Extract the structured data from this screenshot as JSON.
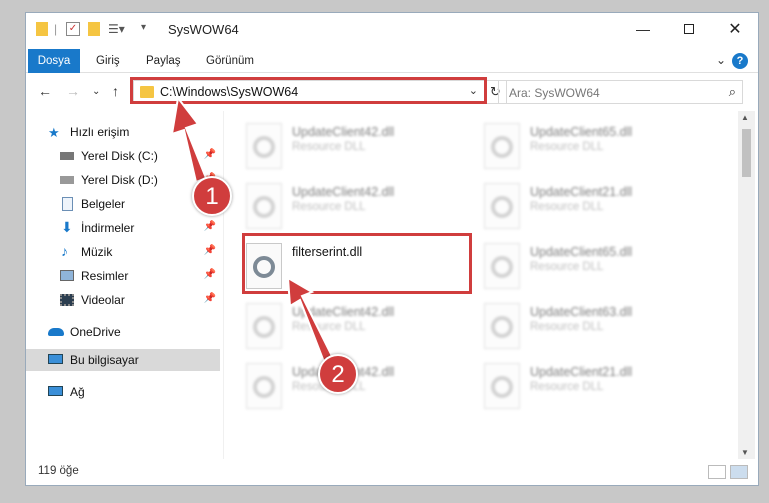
{
  "window": {
    "title": "SysWOW64",
    "minimize_icon": "minimize-icon",
    "maximize_icon": "maximize-icon",
    "close_icon": "close-icon"
  },
  "ribbon": {
    "tabs": [
      "Dosya",
      "Giriş",
      "Paylaş",
      "Görünüm"
    ],
    "help": "?"
  },
  "nav": {
    "back_icon": "back-arrow-icon",
    "forward_icon": "forward-arrow-icon",
    "up_icon": "up-arrow-icon",
    "address": "C:\\Windows\\SysWOW64",
    "search_placeholder": "Ara: SysWOW64"
  },
  "sidebar": {
    "items": [
      {
        "label": "Hızlı erişim",
        "icon": "star-icon",
        "pinned": false
      },
      {
        "label": "Yerel Disk (C:)",
        "icon": "drive-icon",
        "pinned": true
      },
      {
        "label": "Yerel Disk (D:)",
        "icon": "drive-icon",
        "pinned": true
      },
      {
        "label": "Belgeler",
        "icon": "documents-icon",
        "pinned": true
      },
      {
        "label": "İndirmeler",
        "icon": "download-icon",
        "pinned": true
      },
      {
        "label": "Müzik",
        "icon": "music-icon",
        "pinned": true
      },
      {
        "label": "Resimler",
        "icon": "pictures-icon",
        "pinned": true
      },
      {
        "label": "Videolar",
        "icon": "videos-icon",
        "pinned": true
      },
      {
        "label": "OneDrive",
        "icon": "cloud-icon",
        "pinned": false
      },
      {
        "label": "Bu bilgisayar",
        "icon": "computer-icon",
        "pinned": false
      },
      {
        "label": "Ağ",
        "icon": "network-icon",
        "pinned": false
      }
    ]
  },
  "files": [
    {
      "name": "UpdateClient42.dll",
      "type": "Resource DLL"
    },
    {
      "name": "UpdateClient65.dll",
      "type": "Resource DLL"
    },
    {
      "name": "UpdateClient42.dll",
      "type": "Resource DLL"
    },
    {
      "name": "UpdateClient21.dll",
      "type": "Resource DLL"
    },
    {
      "name": "filterserint.dll",
      "type": ""
    },
    {
      "name": "UpdateClient65.dll",
      "type": "Resource DLL"
    },
    {
      "name": "UpdateClient42.dll",
      "type": "Resource DLL"
    },
    {
      "name": "UpdateClient63.dll",
      "type": "Resource DLL"
    },
    {
      "name": "UpdateClient42.dll",
      "type": "Resource DLL"
    },
    {
      "name": "UpdateClient21.dll",
      "type": "Resource DLL"
    }
  ],
  "status": {
    "item_count": "119 öğe"
  },
  "annotations": {
    "step1": "1",
    "step2": "2",
    "accent_color": "#d03d3d"
  }
}
